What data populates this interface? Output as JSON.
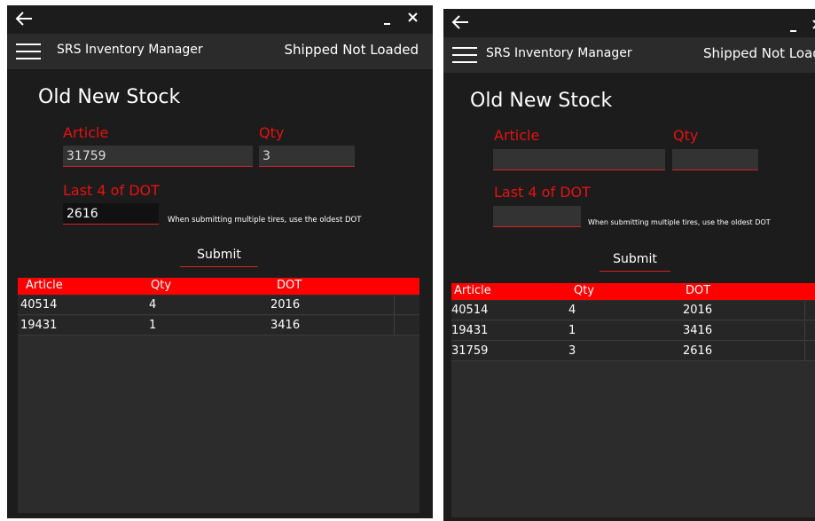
{
  "app": {
    "title": "SRS Inventory Manager",
    "status": "Shipped Not Loaded"
  },
  "page": {
    "title": "Old New Stock",
    "article_label": "Article",
    "qty_label": "Qty",
    "dot_label": "Last 4 of DOT",
    "hint": "When submitting multiple tires, use the oldest DOT",
    "submit_label": "Submit"
  },
  "grid": {
    "columns": [
      "Article",
      "Qty",
      "DOT"
    ]
  },
  "left_window": {
    "article_value": "31759",
    "qty_value": "3",
    "dot_value": "2616",
    "rows": [
      [
        "40514",
        "4",
        "2016"
      ],
      [
        "19431",
        "1",
        "3416"
      ]
    ]
  },
  "right_window": {
    "article_value": "",
    "qty_value": "",
    "dot_value": "",
    "rows": [
      [
        "40514",
        "4",
        "2016"
      ],
      [
        "19431",
        "1",
        "3416"
      ],
      [
        "31759",
        "3",
        "2616"
      ]
    ]
  },
  "colors": {
    "accent": "#ff0000",
    "label": "#e81111",
    "background": "#1c1c1c",
    "appbar": "#2b2b2b"
  }
}
